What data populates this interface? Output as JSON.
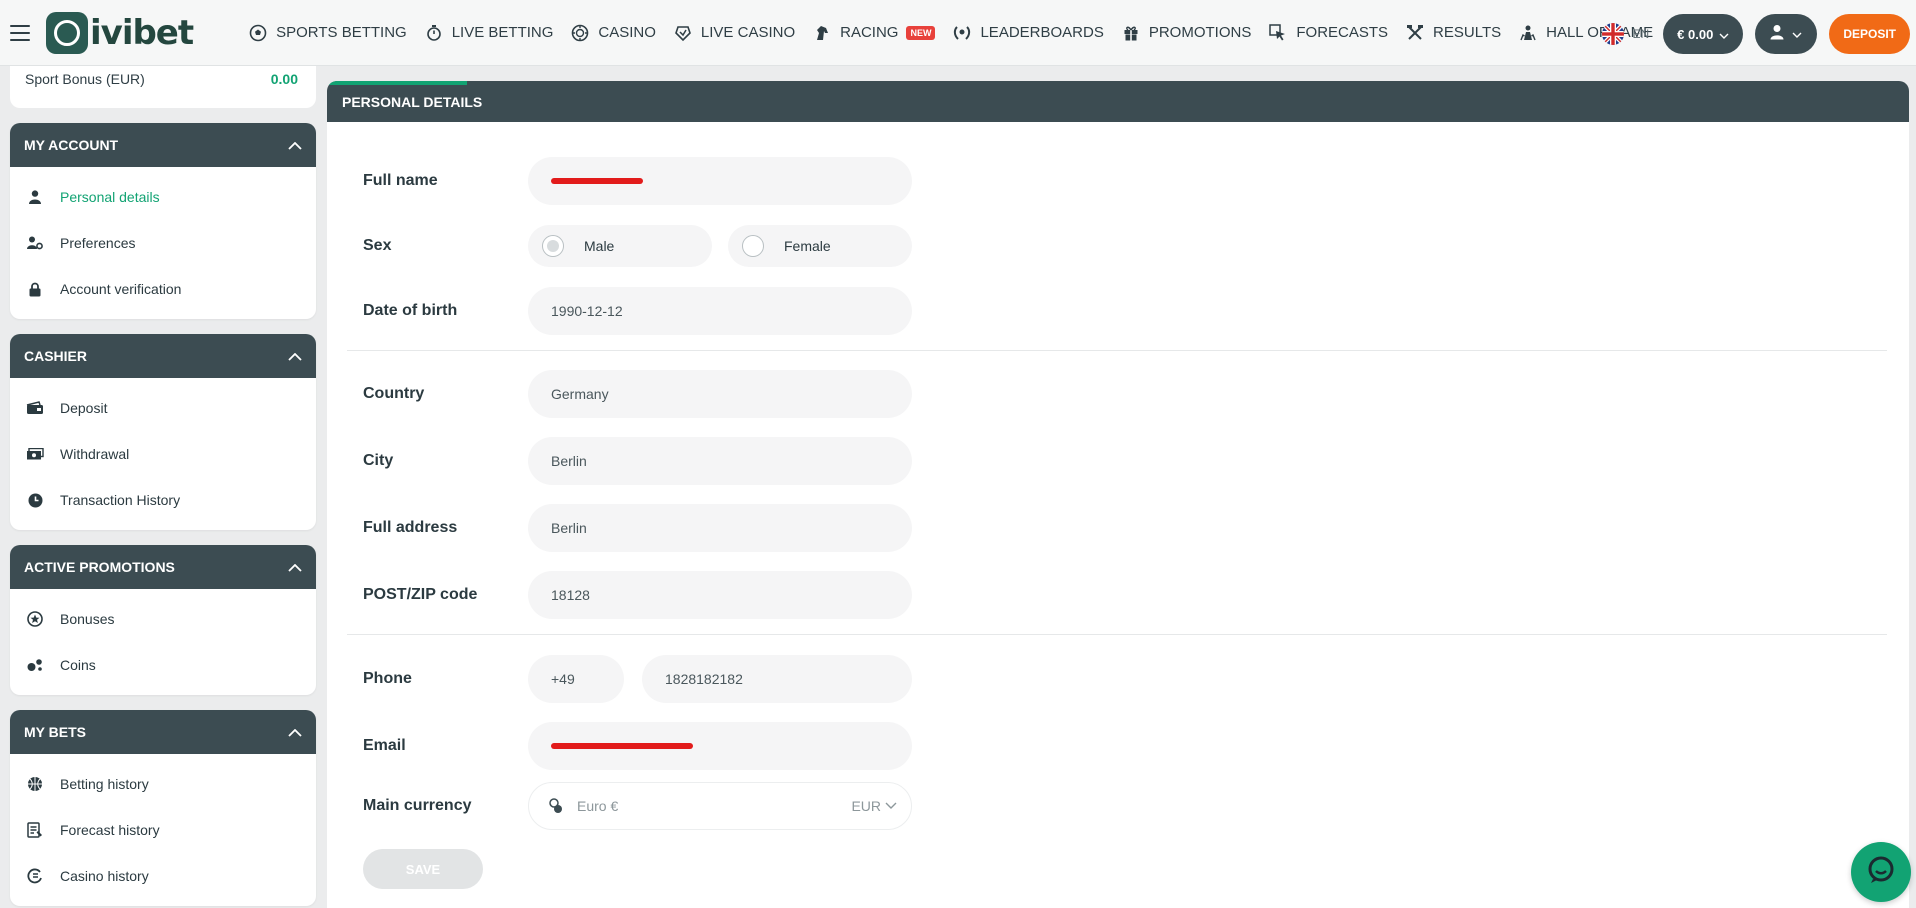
{
  "header": {
    "logo_text": "ivibet",
    "nav": [
      {
        "label": "SPORTS BETTING",
        "icon": "soccer-ball-icon"
      },
      {
        "label": "LIVE BETTING",
        "icon": "stopwatch-icon"
      },
      {
        "label": "CASINO",
        "icon": "casino-chip-icon"
      },
      {
        "label": "LIVE CASINO",
        "icon": "live-casino-icon"
      },
      {
        "label": "RACING",
        "icon": "horse-icon",
        "badge": "NEW"
      },
      {
        "label": "LEADERBOARDS",
        "icon": "laurel-icon"
      },
      {
        "label": "PROMOTIONS",
        "icon": "gift-icon"
      },
      {
        "label": "FORECASTS",
        "icon": "cursor-icon"
      },
      {
        "label": "RESULTS",
        "icon": "crossed-tools-icon"
      },
      {
        "label": "HALL OF FAME",
        "icon": "podium-icon"
      }
    ],
    "language": "EN",
    "balance": "€ 0.00",
    "deposit_label": "DEPOSIT"
  },
  "sidebar": {
    "top_label": "Sport Bonus (EUR)",
    "top_value": "0.00",
    "panels": [
      {
        "title": "MY ACCOUNT",
        "items": [
          {
            "label": "Personal details",
            "icon": "user-icon",
            "active": true
          },
          {
            "label": "Preferences",
            "icon": "user-settings-icon"
          },
          {
            "label": "Account verification",
            "icon": "lock-icon"
          }
        ]
      },
      {
        "title": "CASHIER",
        "items": [
          {
            "label": "Deposit",
            "icon": "wallet-icon"
          },
          {
            "label": "Withdrawal",
            "icon": "cash-icon"
          },
          {
            "label": "Transaction History",
            "icon": "clock-icon"
          }
        ]
      },
      {
        "title": "ACTIVE PROMOTIONS",
        "items": [
          {
            "label": "Bonuses",
            "icon": "star-circle-icon"
          },
          {
            "label": "Coins",
            "icon": "coins-icon"
          }
        ]
      },
      {
        "title": "MY BETS",
        "items": [
          {
            "label": "Betting history",
            "icon": "ball-icon"
          },
          {
            "label": "Forecast history",
            "icon": "list-icon"
          },
          {
            "label": "Casino history",
            "icon": "casino-icon"
          }
        ]
      }
    ]
  },
  "main": {
    "title": "PERSONAL DETAILS",
    "labels": {
      "full_name": "Full name",
      "sex": "Sex",
      "dob": "Date of birth",
      "country": "Country",
      "city": "City",
      "address": "Full address",
      "zip": "POST/ZIP code",
      "phone": "Phone",
      "email": "Email",
      "currency": "Main currency"
    },
    "values": {
      "sex_options": [
        "Male",
        "Female"
      ],
      "sex_selected": "Male",
      "dob": "1990-12-12",
      "country": "Germany",
      "city": "Berlin",
      "address": "Berlin",
      "zip": "18128",
      "phone_code": "+49",
      "phone_number": "1828182182",
      "currency_name": "Euro €",
      "currency_code": "EUR"
    },
    "save_label": "SAVE"
  }
}
